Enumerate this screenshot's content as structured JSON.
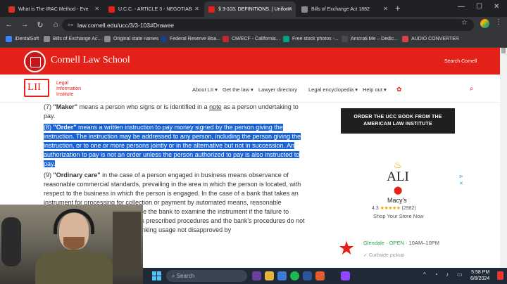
{
  "browser": {
    "tabs": [
      {
        "title": "What is The IRAC Method - Eve",
        "favicon_color": "#d93025",
        "active": false
      },
      {
        "title": "U.C.C. - ARTICLE 3 - NEGOTIAB",
        "favicon_color": "#e32119",
        "active": false
      },
      {
        "title": "§ 3-103. DEFINITIONS. | Uniform",
        "favicon_color": "#e32119",
        "active": true
      },
      {
        "title": "Bills of Exchange Act 1882",
        "favicon_color": "#8a8a8a",
        "active": false
      }
    ],
    "url": "law.cornell.edu/ucc/3/3-103#Drawee",
    "bookmarks": [
      {
        "label": "iDentalSoft",
        "color": "#3b82f6"
      },
      {
        "label": "Bills of Exchange Ac...",
        "color": "#8a8a8a"
      },
      {
        "label": "Original state names",
        "color": "#8a8a8a"
      },
      {
        "label": "Federal Reserve Boa...",
        "color": "#1d3f7a"
      },
      {
        "label": "CM/ECF - California...",
        "color": "#c1272d"
      },
      {
        "label": "Free stock photos -...",
        "color": "#05a081"
      },
      {
        "label": "Amcrati.Me – Dedic...",
        "color": "#4a4a4a"
      },
      {
        "label": "AUDIO CONVERTER",
        "color": "#d64545"
      }
    ]
  },
  "header": {
    "school": "Cornell Law School",
    "search_label": "Search Cornell",
    "lii_mark": "LII",
    "lii_name_1": "Legal",
    "lii_name_2": "Information",
    "lii_name_3": "Institute",
    "nav": [
      "About LII",
      "Get the law",
      "Lawyer directory",
      "Legal encyclopedia",
      "Help out"
    ]
  },
  "article": {
    "p7_num": "(7) ",
    "p7_term": "\"Maker\"",
    "p7_a": " means a person who signs or is identified in a ",
    "p7_link": "note",
    "p7_b": " as a person undertaking to pay.",
    "p8_num": "(8) ",
    "p8_term": "\"Order\"",
    "p8_text": " means a written instruction to pay money signed by the person giving the instruction. The instruction may be addressed to any person, including the person giving the instruction, or to one or more persons jointly or in the alternative but not in succession. An authorization to pay is not an order unless the person authorized to pay is also instructed to pay.",
    "p9_num": "(9) ",
    "p9_term": "\"Ordinary care\"",
    "p9_text": " in the case of a person engaged in business means observance of reasonable commercial standards, prevailing in the area in which the person is located, with respect to the business in which the person is engaged. In the case of a bank that takes an instrument for processing for collection or payment by automated means, reasonable commercial standards do not require the bank to examine the instrument if the failure to examine does not violate the bank's prescribed procedures and the bank's procedures do not vary unreasonably from general banking usage not disapproved by"
  },
  "ads": {
    "order_button": "ORDER THE UCC BOOK FROM THE AMERICAN LAW INSTITUTE",
    "ali_logo": "ALI",
    "store_name": "Macy's",
    "rating_value": "4.3",
    "rating_stars": "★★★★★",
    "rating_count": "(2982)",
    "shop_link": "Shop Your Store Now",
    "store_city": "Glendale",
    "store_status": "OPEN",
    "store_hours": "10AM–10PM",
    "pickup": "Curbside pickup"
  },
  "taskbar": {
    "search_placeholder": "Search",
    "time": "5:58 PM",
    "date": "6/8/2024",
    "tray_chevron": "^"
  }
}
